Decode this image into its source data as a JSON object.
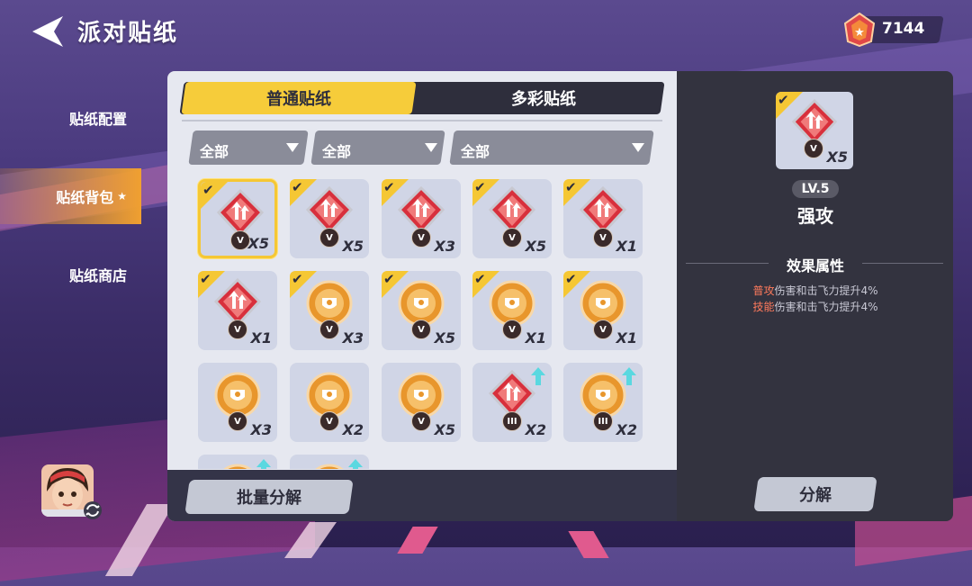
{
  "header": {
    "title": "派对贴纸",
    "currency_value": "7144"
  },
  "sidebar": {
    "items": [
      {
        "label": "贴纸配置",
        "active": false
      },
      {
        "label": "贴纸背包",
        "active": true,
        "star": "★"
      },
      {
        "label": "贴纸商店",
        "active": false
      }
    ]
  },
  "tabs": [
    {
      "label": "普通贴纸",
      "active": true
    },
    {
      "label": "多彩贴纸",
      "active": false
    }
  ],
  "filters": [
    {
      "value": "全部"
    },
    {
      "value": "全部"
    },
    {
      "value": "全部"
    }
  ],
  "stickers": [
    {
      "color": "red",
      "symbol": "arrows-up",
      "rank": "V",
      "count": "X5",
      "equipped": true,
      "selected": true,
      "upgradable": false
    },
    {
      "color": "red",
      "symbol": "swirl",
      "rank": "V",
      "count": "X5",
      "equipped": true,
      "selected": false,
      "upgradable": false
    },
    {
      "color": "red",
      "symbol": "hammer",
      "rank": "V",
      "count": "X3",
      "equipped": true,
      "selected": false,
      "upgradable": false
    },
    {
      "color": "red",
      "symbol": "wing",
      "rank": "V",
      "count": "X5",
      "equipped": true,
      "selected": false,
      "upgradable": false
    },
    {
      "color": "red",
      "symbol": "star-fist",
      "rank": "V",
      "count": "X1",
      "equipped": true,
      "selected": false,
      "upgradable": false
    },
    {
      "color": "red",
      "symbol": "kick",
      "rank": "V",
      "count": "X1",
      "equipped": true,
      "selected": false,
      "upgradable": false
    },
    {
      "color": "orange",
      "symbol": "dash",
      "rank": "V",
      "count": "X3",
      "equipped": true,
      "selected": false,
      "upgradable": false
    },
    {
      "color": "orange",
      "symbol": "shield-arrows",
      "rank": "V",
      "count": "X5",
      "equipped": true,
      "selected": false,
      "upgradable": false
    },
    {
      "color": "orange",
      "symbol": "shield-star",
      "rank": "V",
      "count": "X1",
      "equipped": true,
      "selected": false,
      "upgradable": false
    },
    {
      "color": "orange",
      "symbol": "shield-swirl",
      "rank": "V",
      "count": "X1",
      "equipped": true,
      "selected": false,
      "upgradable": false
    },
    {
      "color": "orange",
      "symbol": "dash",
      "rank": "V",
      "count": "X3",
      "equipped": false,
      "selected": false,
      "upgradable": false
    },
    {
      "color": "orange",
      "symbol": "figure",
      "rank": "V",
      "count": "X2",
      "equipped": false,
      "selected": false,
      "upgradable": false
    },
    {
      "color": "orange",
      "symbol": "heart-arrow",
      "rank": "V",
      "count": "X5",
      "equipped": false,
      "selected": false,
      "upgradable": false
    },
    {
      "color": "red",
      "symbol": "arrows-up",
      "rank": "III",
      "count": "X2",
      "equipped": false,
      "selected": false,
      "upgradable": true
    },
    {
      "color": "orange",
      "symbol": "shield-swirl",
      "rank": "III",
      "count": "X2",
      "equipped": false,
      "selected": false,
      "upgradable": true
    },
    {
      "color": "orange",
      "symbol": "dash",
      "rank": "",
      "count": "",
      "equipped": false,
      "selected": false,
      "upgradable": true
    },
    {
      "color": "orange",
      "symbol": "figure",
      "rank": "",
      "count": "",
      "equipped": false,
      "selected": false,
      "upgradable": true
    }
  ],
  "batch_button": "批量分解",
  "detail": {
    "rank": "V",
    "count": "X5",
    "level": "LV.5",
    "name": "强攻",
    "section_title": "效果属性",
    "attributes": [
      {
        "key": "普攻",
        "text": "伤害和击飞力提升4%"
      },
      {
        "key": "技能",
        "text": "伤害和击飞力提升4%"
      }
    ],
    "decompose_button": "分解"
  },
  "colors": {
    "accent": "#f6cc3a",
    "sticker_red": "#d8303c",
    "sticker_orange": "#e8962c",
    "attr_key": "#ff7a5c"
  }
}
